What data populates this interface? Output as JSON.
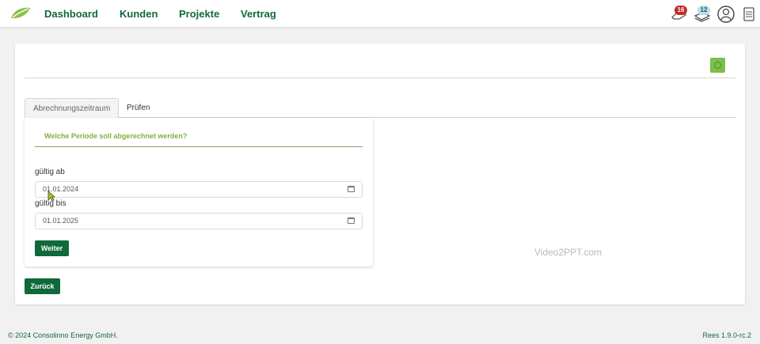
{
  "nav": {
    "items": [
      "Dashboard",
      "Kunden",
      "Projekte",
      "Vertrag"
    ]
  },
  "toolbar": {
    "notifications_count": "16",
    "messages_count": "12",
    "icons": [
      "notifications-hand-icon",
      "messages-icon",
      "user-avatar-icon",
      "document-icon"
    ]
  },
  "tabs": [
    "Abrechnungszeitraum",
    "Prüfen"
  ],
  "form": {
    "question": "Welche Periode soll abgerechnet werden?",
    "valid_from_label": "gültig ab",
    "valid_from_value": "01.01.2024",
    "valid_to_label": "gültig bis",
    "valid_to_value": "01.01.2025",
    "next_button": "Weiter"
  },
  "back_button": "Zurück",
  "watermark": "Video2PPT.com",
  "footer": {
    "copyright": "© 2024 Consolinno Energy GmbH.",
    "version": "Rees 1.9.0-rc.2"
  },
  "colors": {
    "primary": "#0f6a3a",
    "accent": "#7cb342",
    "badge_red": "#c62828",
    "badge_blue": "#b9dfe8"
  }
}
